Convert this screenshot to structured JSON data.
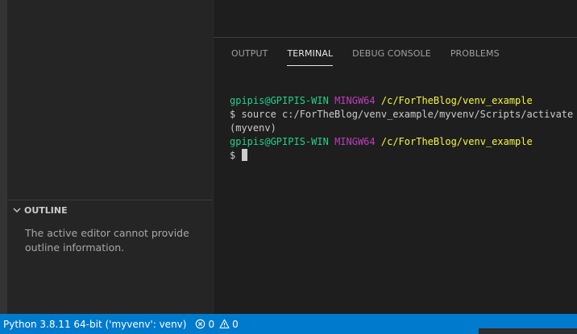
{
  "sidebar": {
    "outline": {
      "title": "OUTLINE",
      "message": "The active editor cannot provide outline information."
    }
  },
  "panel": {
    "tabs": [
      {
        "label": "OUTPUT",
        "active": false
      },
      {
        "label": "TERMINAL",
        "active": true
      },
      {
        "label": "DEBUG CONSOLE",
        "active": false
      },
      {
        "label": "PROBLEMS",
        "active": false
      }
    ]
  },
  "terminal": {
    "prompt1": {
      "user": "gpipis@GPIPIS-WIN",
      "env": "MINGW64",
      "path": "/c/ForTheBlog/venv_example"
    },
    "command": "$ source c:/ForTheBlog/venv_example/myvenv/Scripts/activate",
    "venv": "(myvenv)",
    "prompt2": {
      "user": "gpipis@GPIPIS-WIN",
      "env": "MINGW64",
      "path": "/c/ForTheBlog/venv_example"
    },
    "input_prefix": "$ "
  },
  "statusbar": {
    "interpreter": "Python 3.8.11 64-bit ('myvenv': venv)",
    "errors": "0",
    "warnings": "0"
  },
  "colors": {
    "statusbar": "#007acc",
    "prompt_user": "#23d18b",
    "prompt_env": "#bc3fbc",
    "prompt_path": "#f5f543"
  },
  "icons": {
    "outline_toggle": "chevron-down-icon",
    "errors": "error-circle-icon",
    "warnings": "warning-triangle-icon"
  }
}
